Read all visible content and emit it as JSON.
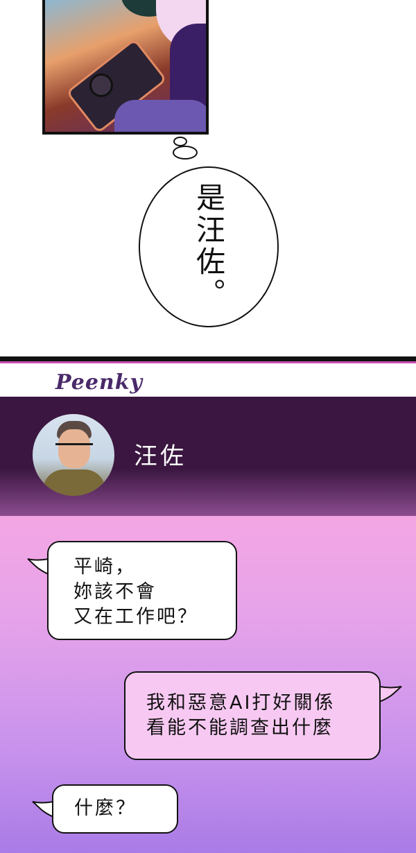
{
  "thought": {
    "text": "是汪佐。"
  },
  "app": {
    "logo": "Peenky",
    "contact": {
      "name": "汪佐"
    },
    "messages": [
      {
        "side": "incoming",
        "lines": [
          "平崎，",
          "妳該不會",
          "又在工作吧？"
        ]
      },
      {
        "side": "outgoing",
        "lines": [
          "我和惡意AI打好關係",
          "看能不能調查出什麼"
        ]
      },
      {
        "side": "incoming",
        "lines": [
          "什麼？"
        ]
      }
    ]
  },
  "colors": {
    "header_bg": "#3a1640",
    "chat_top": "#f4a6e4",
    "chat_bottom": "#a97be6",
    "outgoing_bubble": "#f7c9f2",
    "incoming_bubble": "#ffffff",
    "logo": "#4a2a6a"
  }
}
